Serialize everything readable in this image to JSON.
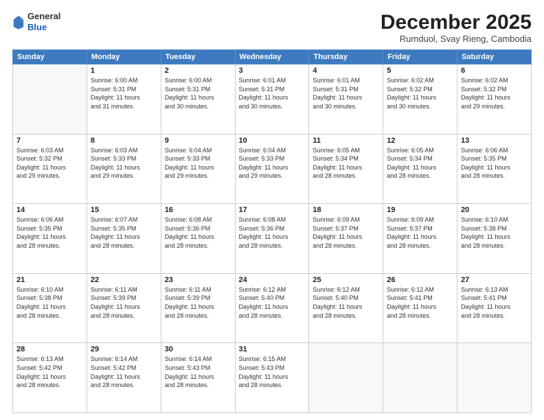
{
  "header": {
    "logo_general": "General",
    "logo_blue": "Blue",
    "month_title": "December 2025",
    "location": "Rumduol, Svay Rieng, Cambodia"
  },
  "days_of_week": [
    "Sunday",
    "Monday",
    "Tuesday",
    "Wednesday",
    "Thursday",
    "Friday",
    "Saturday"
  ],
  "weeks": [
    [
      {
        "day": "",
        "info": ""
      },
      {
        "day": "1",
        "info": "Sunrise: 6:00 AM\nSunset: 5:31 PM\nDaylight: 11 hours\nand 31 minutes."
      },
      {
        "day": "2",
        "info": "Sunrise: 6:00 AM\nSunset: 5:31 PM\nDaylight: 11 hours\nand 30 minutes."
      },
      {
        "day": "3",
        "info": "Sunrise: 6:01 AM\nSunset: 5:31 PM\nDaylight: 11 hours\nand 30 minutes."
      },
      {
        "day": "4",
        "info": "Sunrise: 6:01 AM\nSunset: 5:31 PM\nDaylight: 11 hours\nand 30 minutes."
      },
      {
        "day": "5",
        "info": "Sunrise: 6:02 AM\nSunset: 5:32 PM\nDaylight: 11 hours\nand 30 minutes."
      },
      {
        "day": "6",
        "info": "Sunrise: 6:02 AM\nSunset: 5:32 PM\nDaylight: 11 hours\nand 29 minutes."
      }
    ],
    [
      {
        "day": "7",
        "info": "Sunrise: 6:03 AM\nSunset: 5:32 PM\nDaylight: 11 hours\nand 29 minutes."
      },
      {
        "day": "8",
        "info": "Sunrise: 6:03 AM\nSunset: 5:33 PM\nDaylight: 11 hours\nand 29 minutes."
      },
      {
        "day": "9",
        "info": "Sunrise: 6:04 AM\nSunset: 5:33 PM\nDaylight: 11 hours\nand 29 minutes."
      },
      {
        "day": "10",
        "info": "Sunrise: 6:04 AM\nSunset: 5:33 PM\nDaylight: 11 hours\nand 29 minutes."
      },
      {
        "day": "11",
        "info": "Sunrise: 6:05 AM\nSunset: 5:34 PM\nDaylight: 11 hours\nand 28 minutes."
      },
      {
        "day": "12",
        "info": "Sunrise: 6:05 AM\nSunset: 5:34 PM\nDaylight: 11 hours\nand 28 minutes."
      },
      {
        "day": "13",
        "info": "Sunrise: 6:06 AM\nSunset: 5:35 PM\nDaylight: 11 hours\nand 28 minutes."
      }
    ],
    [
      {
        "day": "14",
        "info": "Sunrise: 6:06 AM\nSunset: 5:35 PM\nDaylight: 11 hours\nand 28 minutes."
      },
      {
        "day": "15",
        "info": "Sunrise: 6:07 AM\nSunset: 5:35 PM\nDaylight: 11 hours\nand 28 minutes."
      },
      {
        "day": "16",
        "info": "Sunrise: 6:08 AM\nSunset: 5:36 PM\nDaylight: 11 hours\nand 28 minutes."
      },
      {
        "day": "17",
        "info": "Sunrise: 6:08 AM\nSunset: 5:36 PM\nDaylight: 11 hours\nand 28 minutes."
      },
      {
        "day": "18",
        "info": "Sunrise: 6:09 AM\nSunset: 5:37 PM\nDaylight: 11 hours\nand 28 minutes."
      },
      {
        "day": "19",
        "info": "Sunrise: 6:09 AM\nSunset: 5:37 PM\nDaylight: 11 hours\nand 28 minutes."
      },
      {
        "day": "20",
        "info": "Sunrise: 6:10 AM\nSunset: 5:38 PM\nDaylight: 11 hours\nand 28 minutes."
      }
    ],
    [
      {
        "day": "21",
        "info": "Sunrise: 6:10 AM\nSunset: 5:38 PM\nDaylight: 11 hours\nand 28 minutes."
      },
      {
        "day": "22",
        "info": "Sunrise: 6:11 AM\nSunset: 5:39 PM\nDaylight: 11 hours\nand 28 minutes."
      },
      {
        "day": "23",
        "info": "Sunrise: 6:11 AM\nSunset: 5:39 PM\nDaylight: 11 hours\nand 28 minutes."
      },
      {
        "day": "24",
        "info": "Sunrise: 6:12 AM\nSunset: 5:40 PM\nDaylight: 11 hours\nand 28 minutes."
      },
      {
        "day": "25",
        "info": "Sunrise: 6:12 AM\nSunset: 5:40 PM\nDaylight: 11 hours\nand 28 minutes."
      },
      {
        "day": "26",
        "info": "Sunrise: 6:12 AM\nSunset: 5:41 PM\nDaylight: 11 hours\nand 28 minutes."
      },
      {
        "day": "27",
        "info": "Sunrise: 6:13 AM\nSunset: 5:41 PM\nDaylight: 11 hours\nand 28 minutes."
      }
    ],
    [
      {
        "day": "28",
        "info": "Sunrise: 6:13 AM\nSunset: 5:42 PM\nDaylight: 11 hours\nand 28 minutes."
      },
      {
        "day": "29",
        "info": "Sunrise: 6:14 AM\nSunset: 5:42 PM\nDaylight: 11 hours\nand 28 minutes."
      },
      {
        "day": "30",
        "info": "Sunrise: 6:14 AM\nSunset: 5:43 PM\nDaylight: 11 hours\nand 28 minutes."
      },
      {
        "day": "31",
        "info": "Sunrise: 6:15 AM\nSunset: 5:43 PM\nDaylight: 11 hours\nand 28 minutes."
      },
      {
        "day": "",
        "info": ""
      },
      {
        "day": "",
        "info": ""
      },
      {
        "day": "",
        "info": ""
      }
    ]
  ]
}
